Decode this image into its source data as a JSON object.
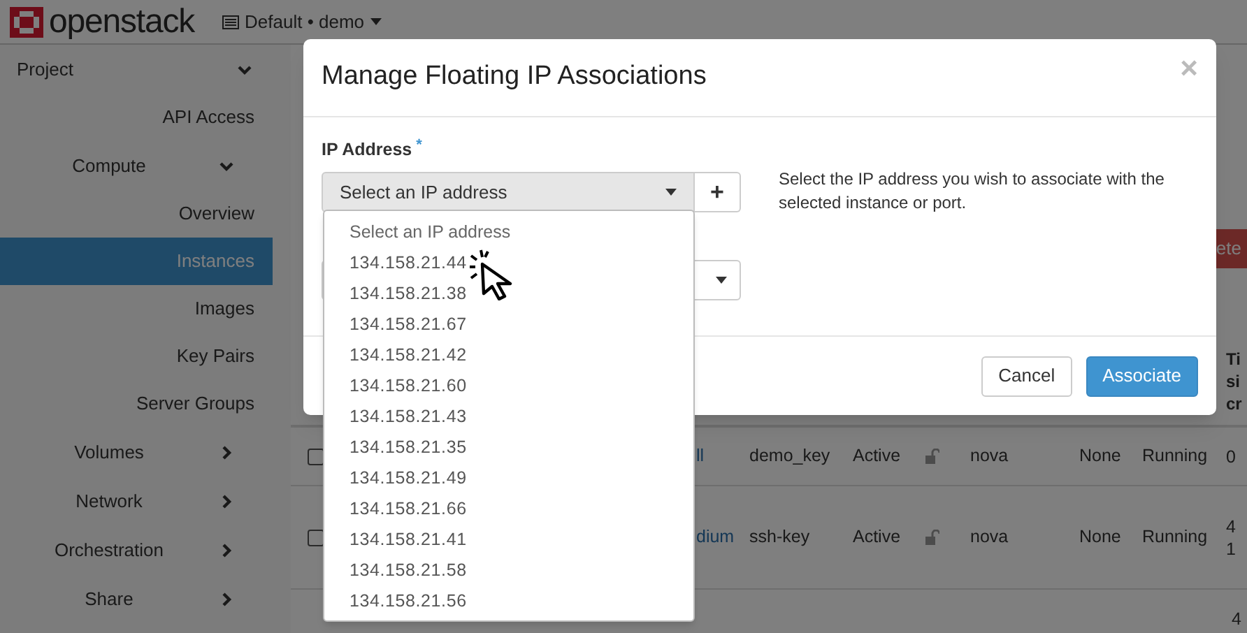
{
  "header": {
    "logo": "openstack",
    "project": "Default • demo"
  },
  "sidebar": {
    "items": [
      {
        "label": "Project",
        "expanded": true,
        "children": [
          {
            "label": "API Access",
            "selected": false
          },
          {
            "label": "Compute",
            "expanded": true,
            "children": [
              {
                "label": "Overview",
                "selected": false
              },
              {
                "label": "Instances",
                "selected": true
              },
              {
                "label": "Images",
                "selected": false
              },
              {
                "label": "Key Pairs",
                "selected": false
              },
              {
                "label": "Server Groups",
                "selected": false
              }
            ]
          },
          {
            "label": "Volumes",
            "expanded": false
          },
          {
            "label": "Network",
            "expanded": false
          },
          {
            "label": "Orchestration",
            "expanded": false
          },
          {
            "label": "Share",
            "expanded": false
          }
        ]
      }
    ]
  },
  "toolbar": {
    "delete_button": "ete"
  },
  "table": {
    "time_header": [
      "Ti",
      "si",
      "cr"
    ],
    "rows": [
      {
        "kind": "full",
        "checked": false,
        "flavor": "ll",
        "key_pair": "demo_key",
        "status": "Active",
        "zone": "nova",
        "task": "None",
        "power": "Running",
        "time": [
          "0"
        ]
      },
      {
        "kind": "full",
        "checked": false,
        "flavor": "dium",
        "key_pair": "ssh-key",
        "status": "Active",
        "zone": "nova",
        "task": "None",
        "power": "Running",
        "time": [
          "4",
          "1"
        ]
      },
      {
        "kind": "cut",
        "time": [
          "4"
        ]
      }
    ]
  },
  "modal": {
    "title": "Manage Floating IP Associations",
    "close": "×",
    "field_label": "IP Address",
    "required_mark": "*",
    "select": {
      "placeholder": "Select an IP address",
      "add_button": "+"
    },
    "help": "Select the IP address you wish to associate with the selected instance or port.",
    "dropdown": {
      "options": [
        {
          "label": "Select an IP address",
          "kind": "placeholder"
        },
        {
          "label": "134.158.21.44",
          "kind": "option"
        },
        {
          "label": "134.158.21.38",
          "kind": "option"
        },
        {
          "label": "134.158.21.67",
          "kind": "option"
        },
        {
          "label": "134.158.21.42",
          "kind": "option"
        },
        {
          "label": "134.158.21.60",
          "kind": "option"
        },
        {
          "label": "134.158.21.43",
          "kind": "option"
        },
        {
          "label": "134.158.21.35",
          "kind": "option"
        },
        {
          "label": "134.158.21.49",
          "kind": "option"
        },
        {
          "label": "134.158.21.66",
          "kind": "option"
        },
        {
          "label": "134.158.21.41",
          "kind": "option"
        },
        {
          "label": "134.158.21.58",
          "kind": "option"
        },
        {
          "label": "134.158.21.56",
          "kind": "option"
        }
      ]
    },
    "buttons": [
      {
        "label": "Cancel",
        "kind": "default"
      },
      {
        "label": "Associate",
        "kind": "primary"
      }
    ]
  }
}
